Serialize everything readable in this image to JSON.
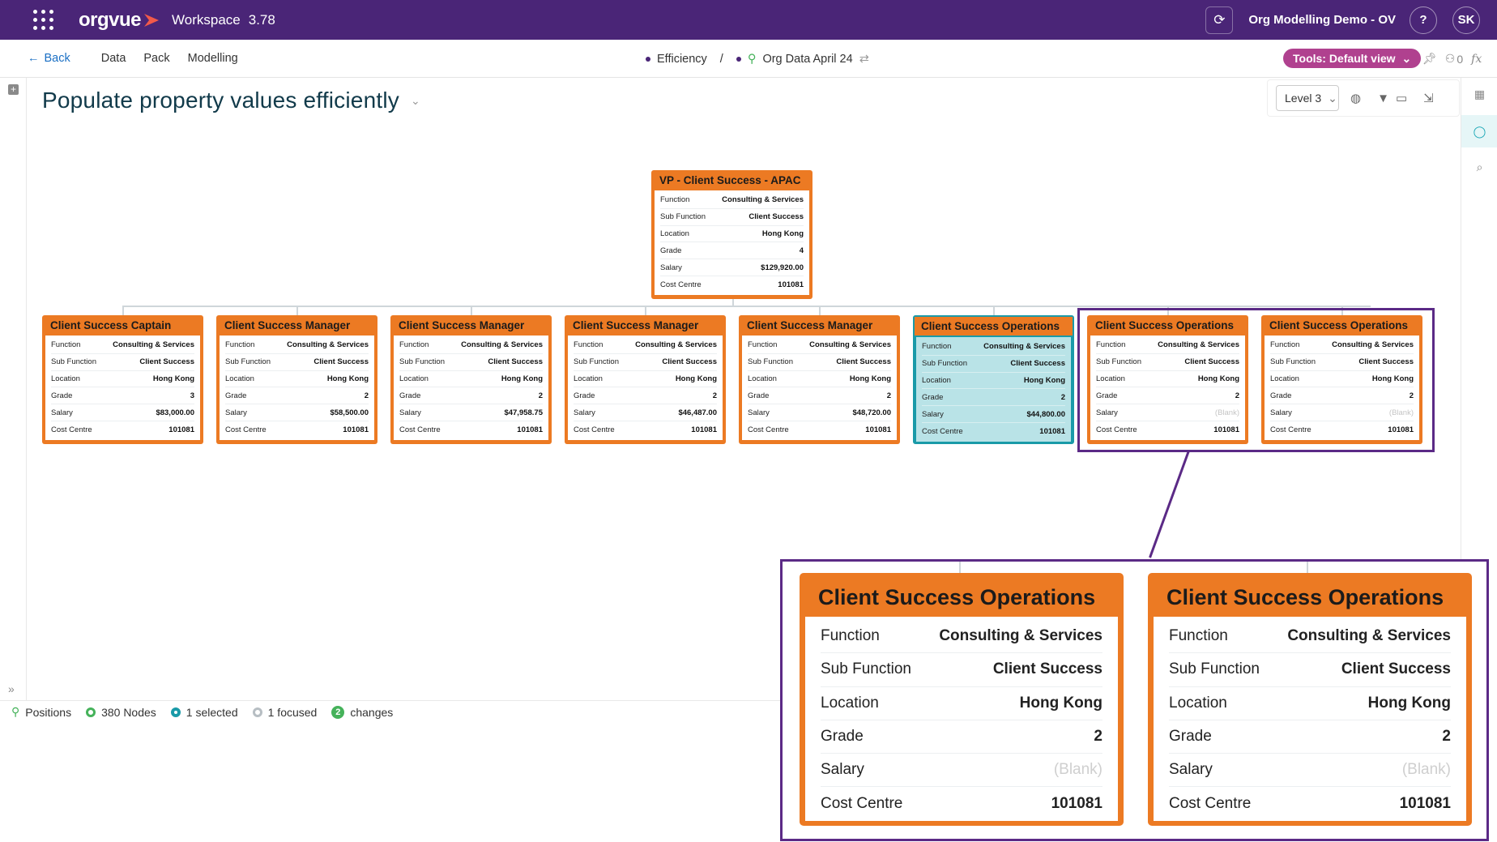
{
  "topbar": {
    "logo": "orgvue",
    "workspace": "Workspace",
    "version": "3.78",
    "project": "Org Modelling Demo - OV",
    "help": "?",
    "avatar": "SK"
  },
  "navbar": {
    "back": "Back",
    "items": [
      "Data",
      "Pack",
      "Modelling"
    ],
    "crumb1": "Efficiency",
    "sep": "/",
    "crumb2": "Org Data April 24",
    "tools": "Tools: Default view",
    "count": "0"
  },
  "page": {
    "title": "Populate property values efficiently"
  },
  "view": {
    "level": "Level 3"
  },
  "labels": {
    "function": "Function",
    "sub_function": "Sub Function",
    "location": "Location",
    "grade": "Grade",
    "salary": "Salary",
    "cost_centre": "Cost Centre"
  },
  "root": {
    "title": "VP - Client Success - APAC",
    "function": "Consulting & Services",
    "sub_function": "Client Success",
    "location": "Hong Kong",
    "grade": "4",
    "salary": "$129,920.00",
    "cost_centre": "101081"
  },
  "cards": [
    {
      "title": "Client Success Captain",
      "function": "Consulting & Services",
      "sub_function": "Client Success",
      "location": "Hong Kong",
      "grade": "3",
      "salary": "$83,000.00",
      "cost_centre": "101081"
    },
    {
      "title": "Client Success Manager",
      "function": "Consulting & Services",
      "sub_function": "Client Success",
      "location": "Hong Kong",
      "grade": "2",
      "salary": "$58,500.00",
      "cost_centre": "101081"
    },
    {
      "title": "Client Success Manager",
      "function": "Consulting & Services",
      "sub_function": "Client Success",
      "location": "Hong Kong",
      "grade": "2",
      "salary": "$47,958.75",
      "cost_centre": "101081"
    },
    {
      "title": "Client Success Manager",
      "function": "Consulting & Services",
      "sub_function": "Client Success",
      "location": "Hong Kong",
      "grade": "2",
      "salary": "$46,487.00",
      "cost_centre": "101081"
    },
    {
      "title": "Client Success Manager",
      "function": "Consulting & Services",
      "sub_function": "Client Success",
      "location": "Hong Kong",
      "grade": "2",
      "salary": "$48,720.00",
      "cost_centre": "101081"
    },
    {
      "title": "Client Success Operations",
      "function": "Consulting & Services",
      "sub_function": "Client Success",
      "location": "Hong Kong",
      "grade": "2",
      "salary": "$44,800.00",
      "cost_centre": "101081"
    },
    {
      "title": "Client Success Operations",
      "function": "Consulting & Services",
      "sub_function": "Client Success",
      "location": "Hong Kong",
      "grade": "2",
      "salary": "(Blank)",
      "cost_centre": "101081"
    },
    {
      "title": "Client Success Operations",
      "function": "Consulting & Services",
      "sub_function": "Client Success",
      "location": "Hong Kong",
      "grade": "2",
      "salary": "(Blank)",
      "cost_centre": "101081"
    }
  ],
  "status": {
    "positions": "Positions",
    "nodes": "380 Nodes",
    "selected": "1 selected",
    "focused": "1 focused",
    "changes_count": "2",
    "changes": "changes"
  }
}
